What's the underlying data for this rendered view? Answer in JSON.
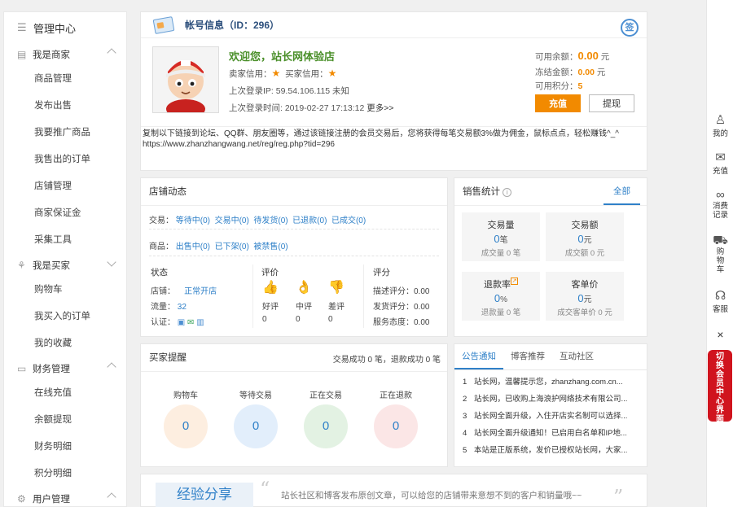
{
  "sidebar": {
    "top": "管理中心",
    "groups": [
      {
        "label": "我是商家",
        "items": [
          "商品管理",
          "发布出售",
          "我要推广商品",
          "我售出的订单",
          "店铺管理",
          "商家保证金",
          "采集工具"
        ]
      },
      {
        "label": "我是买家",
        "items": [
          "购物车",
          "我买入的订单",
          "我的收藏"
        ]
      },
      {
        "label": "财务管理",
        "items": [
          "在线充值",
          "余额提现",
          "财务明细",
          "积分明细"
        ]
      },
      {
        "label": "用户管理",
        "items": []
      }
    ]
  },
  "account": {
    "title": "帐号信息（ID：296）",
    "sign_label": "签",
    "welcome": "欢迎您，站长网体验店",
    "seller_credit": "卖家信用：",
    "buyer_credit": "买家信用：",
    "last_ip": "上次登录IP: 59.54.106.115   未知",
    "last_time": "上次登录时间: 2019-02-27 17:13:12",
    "more": "更多>>",
    "balance_label": "可用余额：",
    "balance_value": "0.00",
    "balance_unit": "元",
    "frozen_label": "冻结金额：",
    "frozen_value": "0.00",
    "frozen_unit": "元",
    "points_label": "可用积分：",
    "points_value": "5",
    "recharge": "充值",
    "withdraw": "提现",
    "promo_line1": "复制以下链接到论坛、QQ群、朋友圈等，通过该链接注册的会员交易后，您将获得每笔交易额3%做为佣金，鼠标点点，轻松赚钱^_^",
    "promo_line2": "https://www.zhanzhangwang.net/reg/reg.php?tid=296"
  },
  "store": {
    "title": "店铺动态",
    "trade_label": "交易：",
    "trade_items": [
      "等待中(0)",
      "交易中(0)",
      "待发货(0)",
      "已退款(0)",
      "已成交(0)"
    ],
    "goods_label": "商品：",
    "goods_items": [
      "出售中(0)",
      "已下架(0)",
      "被禁售(0)"
    ],
    "status_title": "状态",
    "shop_label": "店铺：",
    "shop_value": "正常开店",
    "traffic_label": "流量：",
    "traffic_value": "32",
    "auth_label": "认证：",
    "eval_title": "评价",
    "good": "好评",
    "mid": "中评",
    "bad": "差评",
    "good_n": "0",
    "mid_n": "0",
    "bad_n": "0",
    "score_title": "评分",
    "desc_score": "描述评分：0.00",
    "ship_score": "发货评分：0.00",
    "service_score": "服务态度：0.00"
  },
  "sales": {
    "title": "销售统计",
    "tab_all": "全部",
    "cards": [
      {
        "title": "交易量",
        "value": "0",
        "unit": "笔",
        "sub": "成交量 0 笔"
      },
      {
        "title": "交易额",
        "value": "0",
        "unit": "元",
        "sub": "成交额 0 元"
      },
      {
        "title": "退款率",
        "value": "0",
        "unit": "%",
        "sub": "退款量 0 笔"
      },
      {
        "title": "客单价",
        "value": "0",
        "unit": "元",
        "sub": "成交客单价 0 元"
      }
    ]
  },
  "buyer": {
    "title": "买家提醒",
    "summary": "交易成功 0 笔，退款成功 0 笔",
    "items": [
      {
        "label": "购物车",
        "value": "0",
        "color": "#fdeee0"
      },
      {
        "label": "等待交易",
        "value": "0",
        "color": "#e2eefb"
      },
      {
        "label": "正在交易",
        "value": "0",
        "color": "#e3f2e3"
      },
      {
        "label": "正在退款",
        "value": "0",
        "color": "#fbe6e6"
      }
    ]
  },
  "notice": {
    "tabs": [
      "公告通知",
      "博客推荐",
      "互动社区"
    ],
    "items": [
      "站长网，温馨提示您，zhanzhang.com.cn...",
      "站长网，已收购上海浪护网络技术有限公司...",
      "站长网全面升级，入住开店实名制可以选择...",
      "站长网全面升级通知！已启用白名单和IP地...",
      "本站是正版系统，发价已授权站长网，大家..."
    ]
  },
  "exp": {
    "title": "经验分享",
    "quote_open": "“",
    "quote_close": "”",
    "text": "站长社区和博客发布原创文章，可以给您的店铺带来意想不到的客户和销量哦~~"
  },
  "rail": {
    "items": [
      "我的",
      "充值",
      "消费记录",
      "购物车",
      "客服"
    ],
    "close": "×",
    "switch": "切换会员中心界面"
  }
}
